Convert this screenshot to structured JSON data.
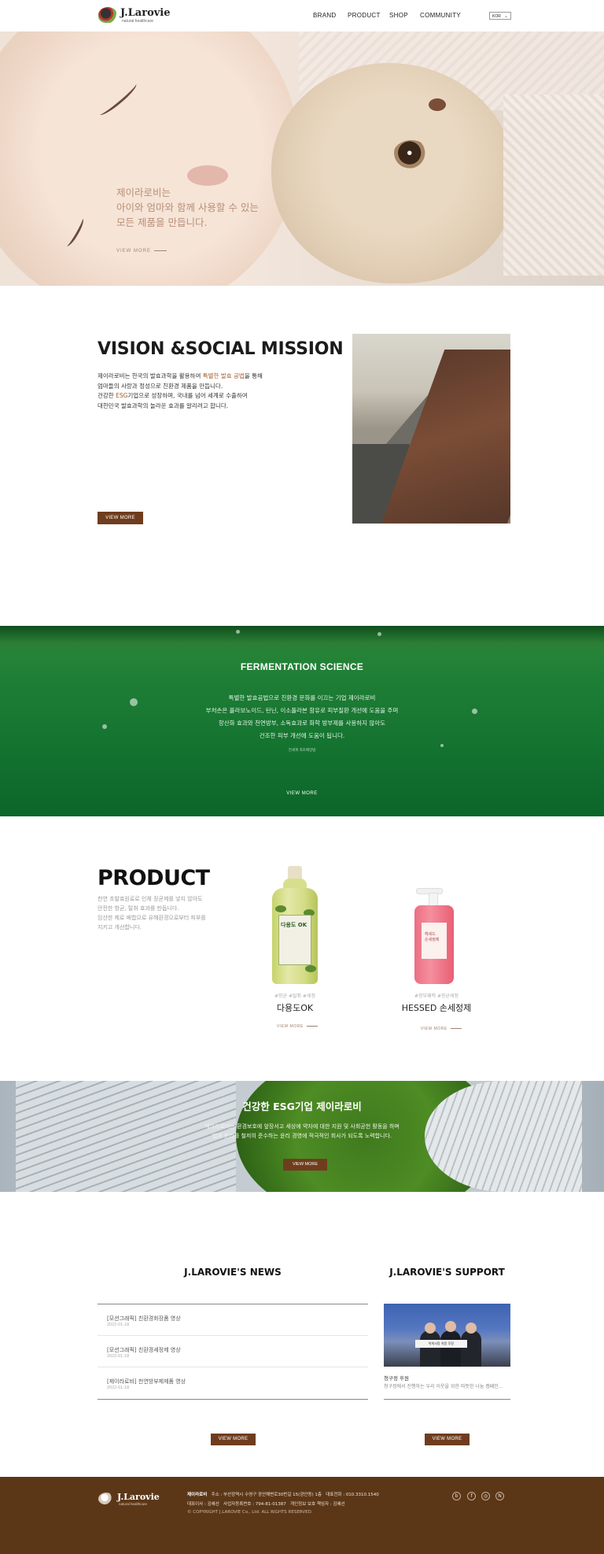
{
  "header": {
    "logo_name": "J.Larovie",
    "logo_tag": "natural healthcare",
    "nav": [
      "BRAND",
      "PRODUCT",
      "SHOP",
      "COMMUNITY"
    ],
    "lang": "KOR"
  },
  "hero": {
    "line1": "제이라로비는",
    "line2": "아이와 엄마와 함께 사용할 수 있는",
    "line3": "모든 제품을 만듭니다.",
    "more": "VIEW MORE"
  },
  "vision": {
    "title": "VISION &SOCIAL MISSION",
    "l1a": "제이라로비는 한국의 발효과학을 활용하여 ",
    "l1b": "특별한 발효 공법",
    "l1c": "을 통해",
    "l2": "엄마들의 사랑과 정성으로 친환경 제품을 만듭니다.",
    "l3a": "건강한 ",
    "l3b": "ESG",
    "l3c": "기업으로 성장하며, 국내를 넘어 세계로 수출하여",
    "l4": "대한민국 발효과학의 놀라운 효과를 알리려고 합니다.",
    "more": "VIEW MORE"
  },
  "ferm": {
    "title": "FERMENTATION SCIENCE",
    "l1": "특별한 발효공법으로 친환경 문화를 이끄는 기업 제이라로비",
    "l2": "부처손은 플라보노이드, 탄닌, 이소플라본 함유로 피부질환 개선에 도움을 주며",
    "l3": "항산화 효과와 천연방부, 소독효과로 화학 방부제를 사용하지 않아도",
    "l4": "건조한 피부 개선에 도움이 됩니다.",
    "sub": "전세계 최초배양법",
    "more": "VIEW MORE"
  },
  "product": {
    "title": "PRODUCT",
    "l1": "천연 초발효원료로 인체 장균제를 넣지 않아도",
    "l2": "안전한 항균, 탈취 효과를 만듭니다.",
    "l3": "임산한 제로 배합으로 유해환경으로부터 피부를",
    "l4": "지키고 개선합니다.",
    "items": [
      {
        "tag": "#항균 #탈취 #세정",
        "name": "다용도OK",
        "label": "다용도 OK",
        "more": "VIEW MORE"
      },
      {
        "tag": "#항부패력 #항균세정",
        "name": "HESSED 손세정제",
        "label1": "헤세드",
        "label2": "손세정제",
        "more": "VIEW MORE"
      }
    ]
  },
  "esg": {
    "title": "건강한 ESG기업 제이라로비",
    "l1": "제이라로비는 환경보호에 앞장서고 세상에 약자에 대한 지원 및 사회공헌 활동을 하며",
    "l2": "법과 윤리를 철저히 준수하는 윤리 경영에 적극적인 회사가 되도록 노력합니다.",
    "button": "VIEW MORE"
  },
  "news": {
    "title": "J.LAROVIE'S NEWS",
    "items": [
      {
        "title": "[모션그래픽] 친환경화장품 영상",
        "date": "2022-01-18"
      },
      {
        "title": "[모션그래픽] 친환경세정제 영상",
        "date": "2022-01-18"
      },
      {
        "title": "[제이라로비] 천연방부제제품 영상",
        "date": "2022-01-18"
      }
    ],
    "button": "VIEW MORE"
  },
  "support": {
    "title": "J.LAROVIE'S SUPPORT",
    "caption": "청구정 후원",
    "desc": "청구정에서 진행하는 우리 이웃을 위한 따뜻한 나눔 캠페인...",
    "banner": "박희사랑 희망 후원",
    "button": "VIEW MORE"
  },
  "footer": {
    "logo_name": "J.Larovie",
    "logo_tag": "natural healthcare",
    "company": "제이라로비",
    "address": "주소 : 부산광역시 수영구 광안해변로30번길 15(광안동) 1층",
    "phone": "대표전화 : 010.3310.1540",
    "ceo": "대표이사 : 김혜선",
    "biz": "사업자등록번호 : 794-81-01387",
    "privacy": "개인정보 보호 책임자 : 김혜선",
    "copyright": "© COPYRIGHT J.LAROVIE Co., Ltd. ALL RIGHTS RESERVED."
  },
  "colors": {
    "accent": "#6f3d1e",
    "footer_bg": "#5b3718",
    "green": "#1e7d35"
  }
}
